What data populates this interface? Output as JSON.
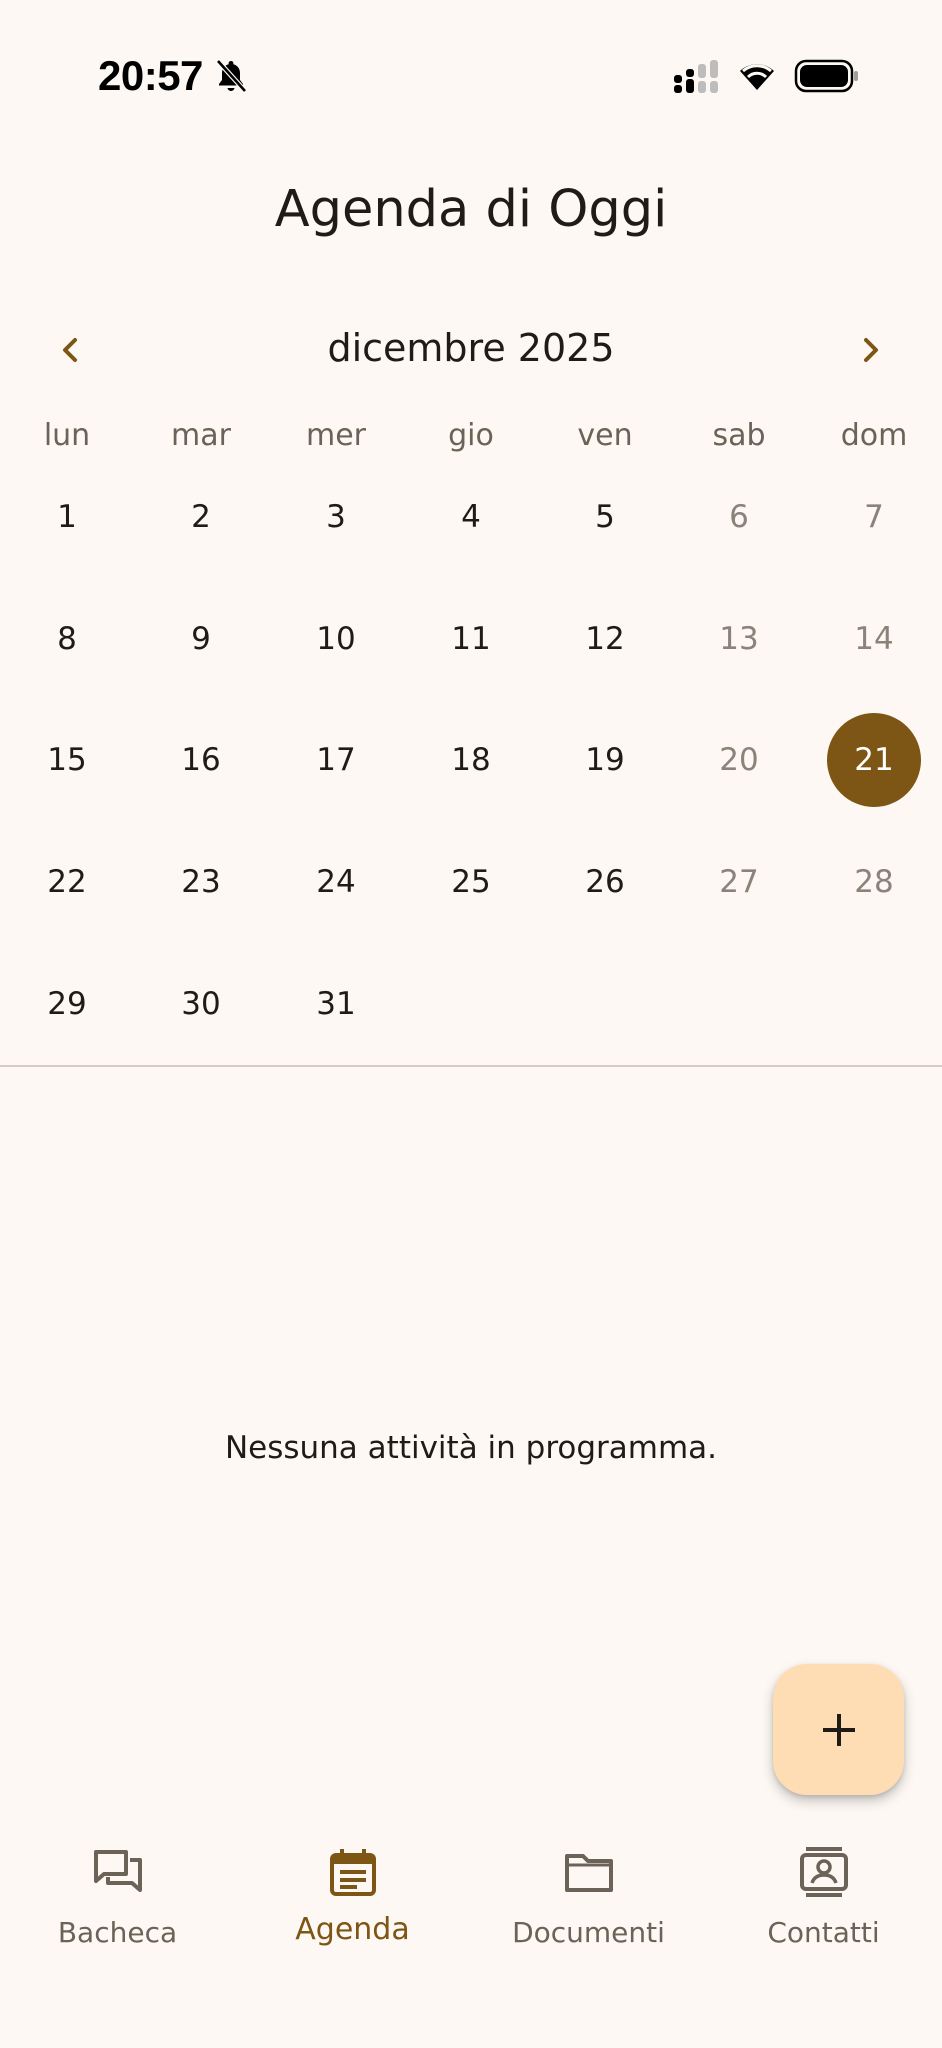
{
  "status_bar": {
    "time": "20:57"
  },
  "header": {
    "title": "Agenda di Oggi"
  },
  "calendar": {
    "month_label": "dicembre 2025",
    "weekdays": [
      "lun",
      "mar",
      "mer",
      "gio",
      "ven",
      "sab",
      "dom"
    ],
    "selected_day": "21",
    "weeks": [
      [
        "1",
        "2",
        "3",
        "4",
        "5",
        "6",
        "7"
      ],
      [
        "8",
        "9",
        "10",
        "11",
        "12",
        "13",
        "14"
      ],
      [
        "15",
        "16",
        "17",
        "18",
        "19",
        "20",
        "21"
      ],
      [
        "22",
        "23",
        "24",
        "25",
        "26",
        "27",
        "28"
      ],
      [
        "29",
        "30",
        "31",
        "",
        "",
        "",
        ""
      ]
    ]
  },
  "main": {
    "empty_message": "Nessuna attività in programma."
  },
  "fab": {
    "icon": "plus-icon"
  },
  "bottom_nav": {
    "items": [
      {
        "label": "Bacheca",
        "icon": "forum-icon"
      },
      {
        "label": "Agenda",
        "icon": "calendar-icon"
      },
      {
        "label": "Documenti",
        "icon": "folder-icon"
      },
      {
        "label": "Contatti",
        "icon": "contacts-icon"
      }
    ],
    "active_index": 1
  },
  "colors": {
    "background": "#fdf8f3",
    "accent": "#7d5514",
    "fab": "#ffddb4",
    "text": "#1f1b16",
    "muted": "#6b6258"
  }
}
